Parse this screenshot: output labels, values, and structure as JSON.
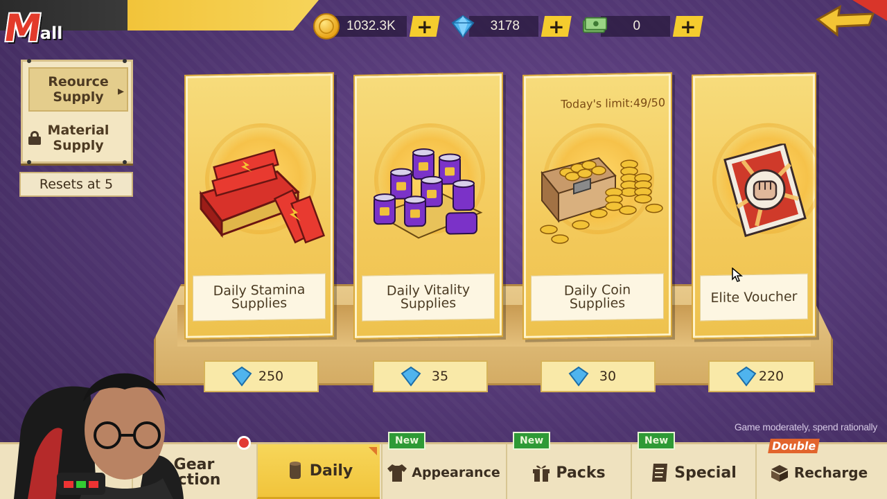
{
  "header": {
    "logo_text_m": "M",
    "logo_text_all": "all"
  },
  "currencies": [
    {
      "icon": "gold-coin-icon",
      "value": "1032.3K",
      "add_label": "+"
    },
    {
      "icon": "diamond-icon",
      "value": "3178",
      "add_label": "+"
    },
    {
      "icon": "cash-stack-icon",
      "value": "0",
      "add_label": "+"
    }
  ],
  "side_panel": {
    "tabs": [
      {
        "label": "Reource Supply",
        "active": true
      },
      {
        "label": "Material Supply",
        "locked": true
      }
    ],
    "resets_text": "Resets at 5"
  },
  "cards": [
    {
      "name": "Daily Stamina Supplies",
      "price": "250",
      "limit": "",
      "art": "stamina-bars"
    },
    {
      "name": "Daily Vitality Supplies",
      "price": "35",
      "limit": "",
      "art": "vitality-cans"
    },
    {
      "name": "Daily Coin Supplies",
      "price": "30",
      "limit": "Today's limit:49/50",
      "art": "coin-chest"
    },
    {
      "name": "Elite Voucher",
      "price": "220",
      "limit": "",
      "art": "fist-voucher"
    }
  ],
  "hint_text": "Game moderately, spend rationally",
  "bottom_nav": [
    {
      "label": "Gear\nection",
      "icon": "",
      "badge": "",
      "dot": true,
      "active": false
    },
    {
      "label": "Daily",
      "icon": "can-icon",
      "badge": "",
      "active": true
    },
    {
      "label": "Appearance",
      "icon": "shirt-icon",
      "badge": "New",
      "active": false
    },
    {
      "label": "Packs",
      "icon": "gift-icon",
      "badge": "New",
      "active": false
    },
    {
      "label": "Special",
      "icon": "scroll-icon",
      "badge": "New",
      "active": false
    },
    {
      "label": "Recharge",
      "icon": "cube-stack-icon",
      "badge": "Double",
      "active": false
    }
  ],
  "colors": {
    "background": "#5b3f7d",
    "accent_yellow": "#f5cc2e",
    "card_gold": "#f3c95a",
    "new_badge": "#2e9a36",
    "double_badge": "#e2642c"
  }
}
